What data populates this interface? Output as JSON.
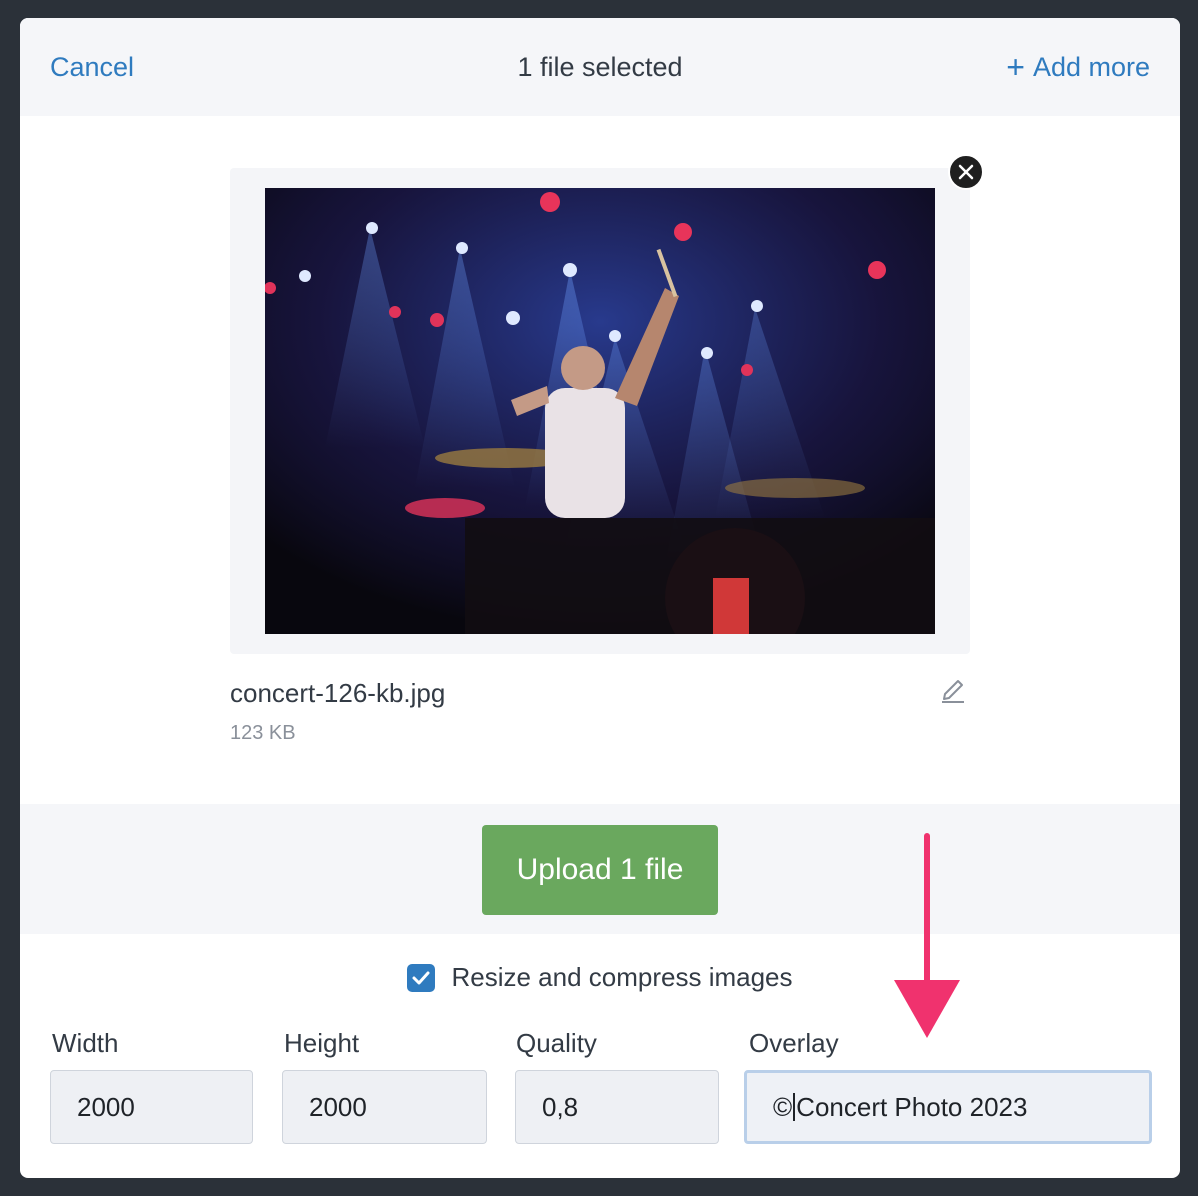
{
  "header": {
    "cancel_label": "Cancel",
    "title": "1 file selected",
    "add_more_label": "Add more"
  },
  "file": {
    "name": "concert-126-kb.jpg",
    "size": "123 KB"
  },
  "upload": {
    "label": "Upload 1 file"
  },
  "resize": {
    "label": "Resize and compress images",
    "checked": true
  },
  "fields": {
    "width": {
      "label": "Width",
      "value": "2000"
    },
    "height": {
      "label": "Height",
      "value": "2000"
    },
    "quality": {
      "label": "Quality",
      "value": "0,8"
    },
    "overlay": {
      "label": "Overlay",
      "value_prefix": "©",
      "value_rest": "Concert Photo 2023"
    }
  },
  "colors": {
    "accent": "#2f7bbf",
    "upload_button": "#6aa85e",
    "annotation_arrow": "#f0326e"
  },
  "icons": [
    "plus-icon",
    "close-icon",
    "pencil-icon",
    "checkmark-icon",
    "arrow-down-icon"
  ]
}
